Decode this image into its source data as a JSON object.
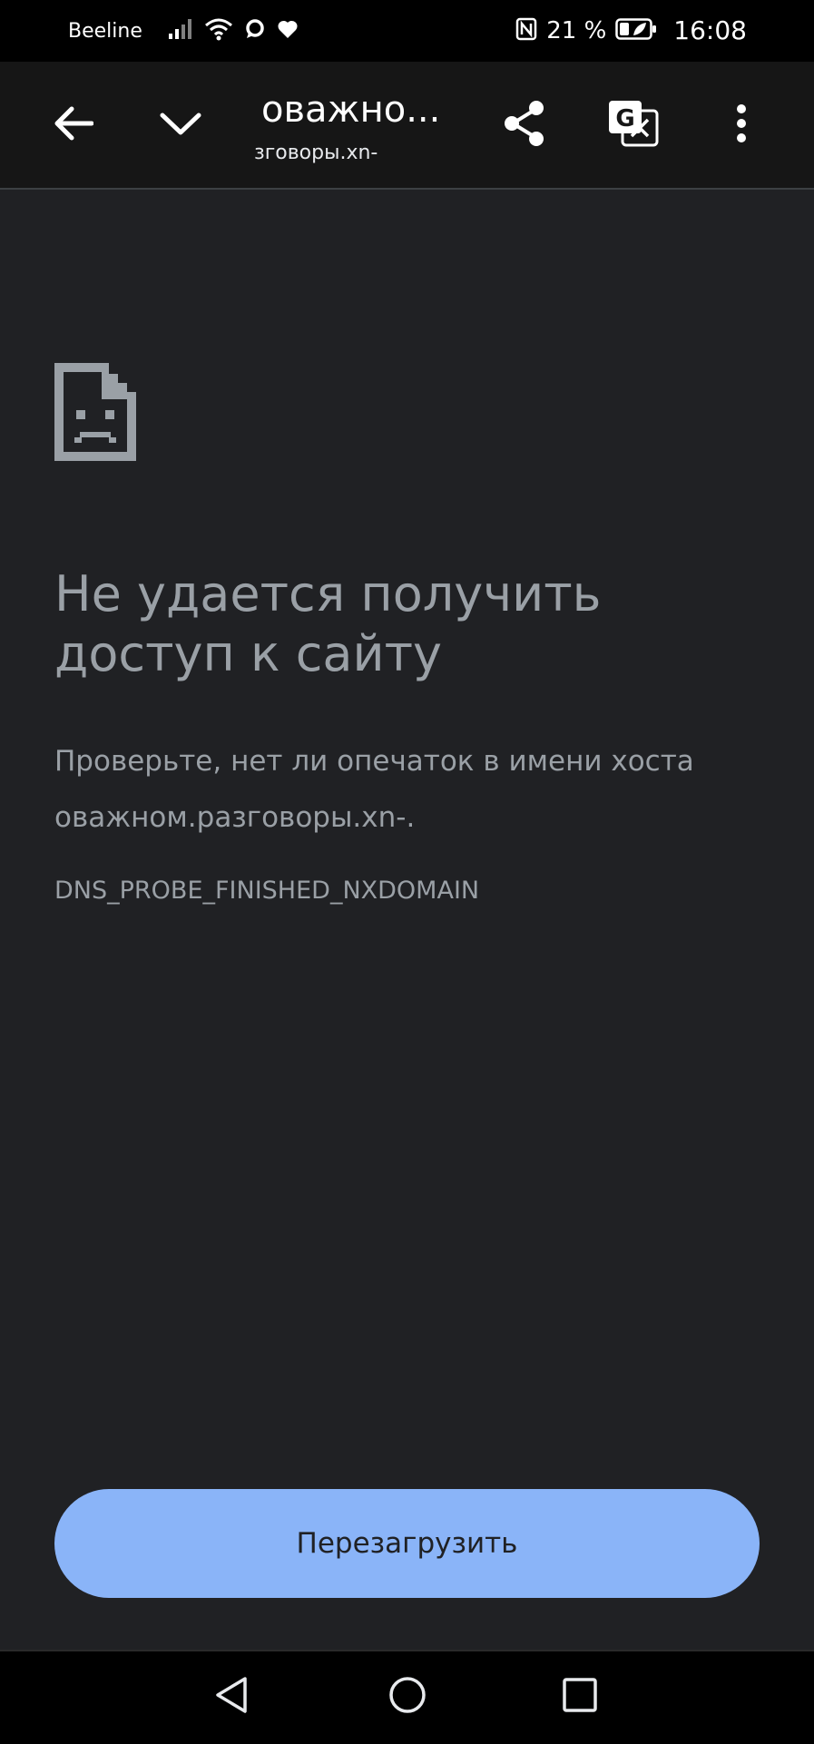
{
  "status_bar": {
    "carrier": "Beeline",
    "battery": "21 %",
    "time": "16:08"
  },
  "toolbar": {
    "title": "оважно...",
    "url": "зговоры.xn-",
    "icons": [
      "back-arrow-icon",
      "chevron-down-icon",
      "share-icon",
      "translate-icon",
      "more-vert-icon"
    ]
  },
  "error": {
    "icon": "sad-page-icon",
    "heading": "Не удается получить доступ к сайту",
    "description": "Проверьте, нет ли опечаток в имени хоста оважном.разговоры.xn-.",
    "code": "DNS_PROBE_FINISHED_NXDOMAIN"
  },
  "reload_button": {
    "label": "Перезагрузить"
  },
  "nav_bar": {
    "icons": [
      "nav-back-icon",
      "nav-home-icon",
      "nav-recents-icon"
    ]
  },
  "colors": {
    "background": "#202124",
    "toolbar": "#161616",
    "text": "#9aa0a6",
    "accent": "#8ab4f8"
  }
}
